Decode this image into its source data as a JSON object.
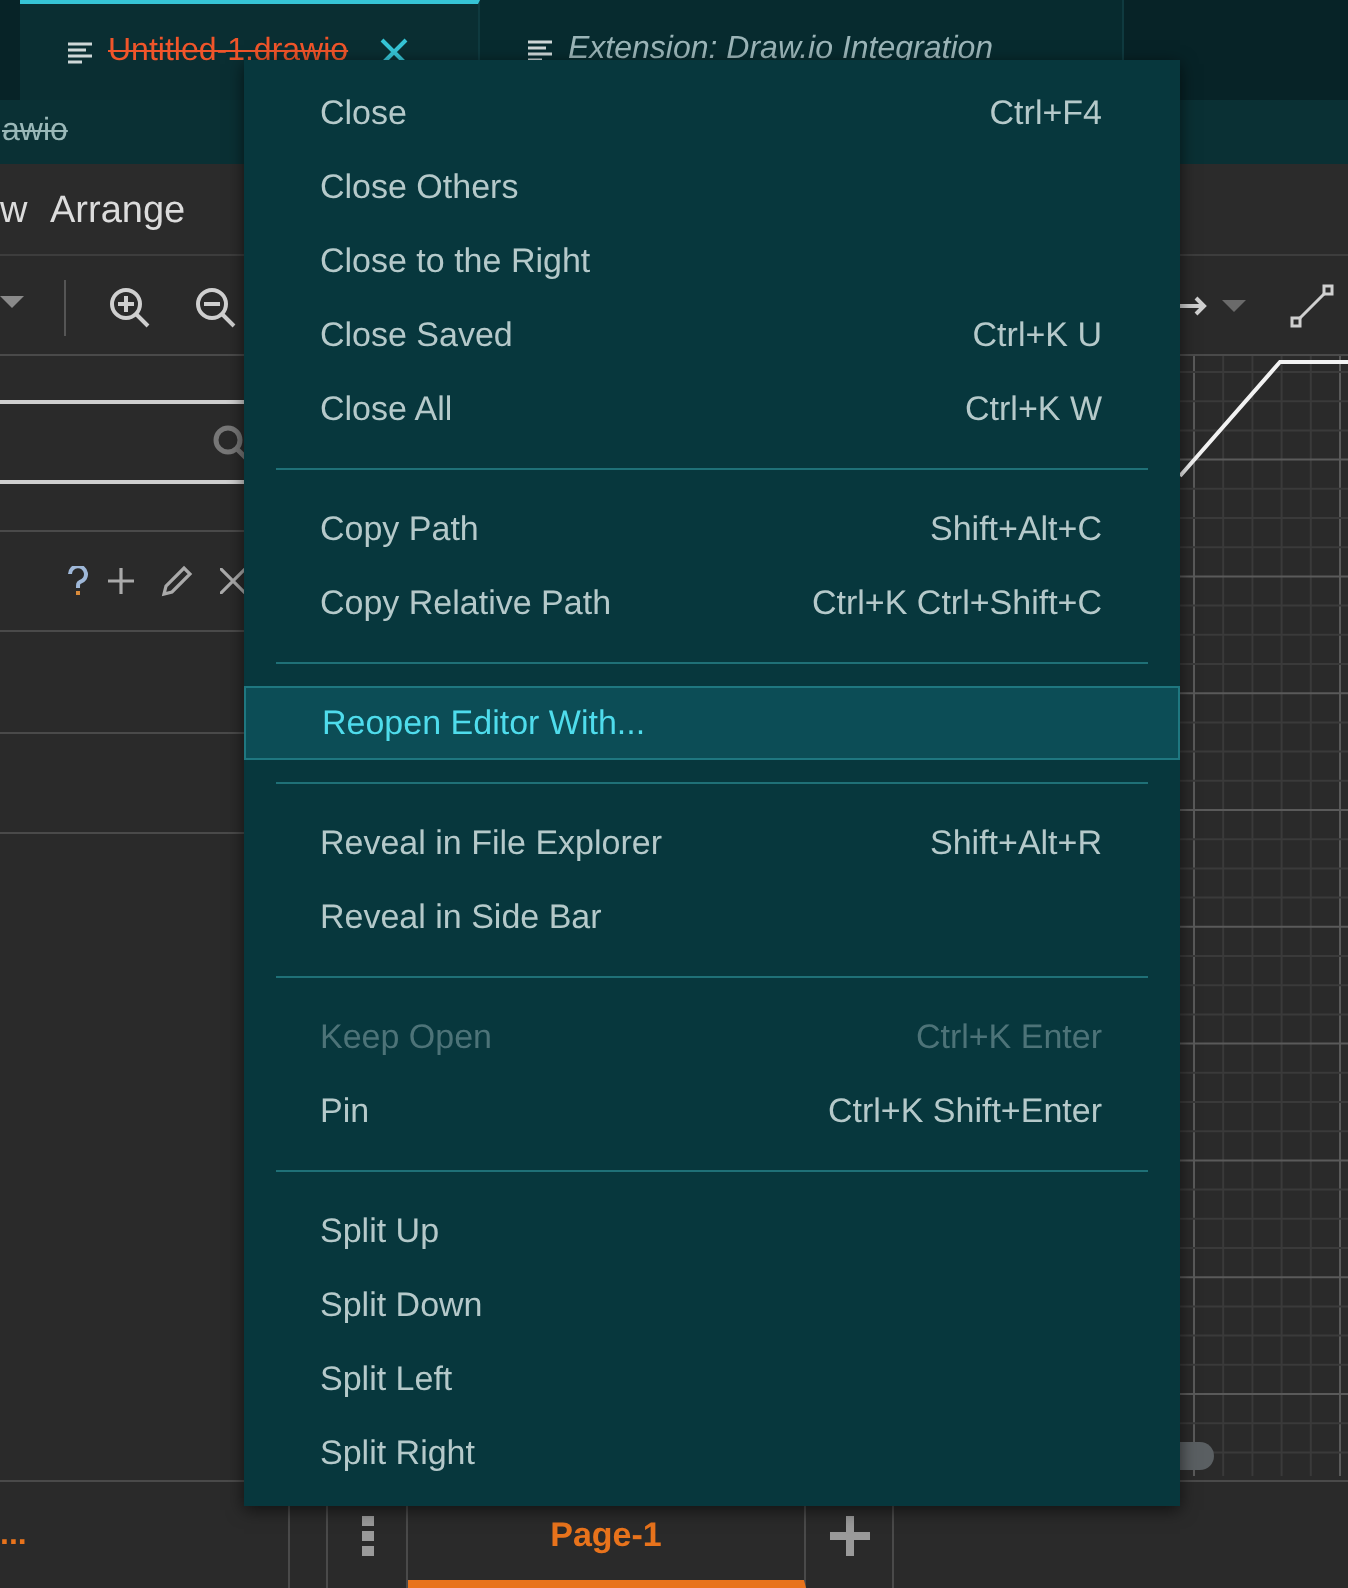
{
  "editor_tabs": [
    {
      "label": "Untitled-1.drawio",
      "selected": true,
      "deleted": true,
      "italic": false
    },
    {
      "label": "Extension: Draw.io Integration",
      "selected": false,
      "deleted": false,
      "italic": true
    }
  ],
  "breadcrumb": {
    "label": "awio",
    "deleted": true
  },
  "menu_bar": [
    "w",
    "Arrange"
  ],
  "context_menu": [
    [
      {
        "label": "Close",
        "shortcut": "Ctrl+F4",
        "disabled": false,
        "selected": false
      },
      {
        "label": "Close Others",
        "disabled": false,
        "selected": false
      },
      {
        "label": "Close to the Right",
        "disabled": false,
        "selected": false
      },
      {
        "label": "Close Saved",
        "shortcut": "Ctrl+K U",
        "disabled": false,
        "selected": false
      },
      {
        "label": "Close All",
        "shortcut": "Ctrl+K W",
        "disabled": false,
        "selected": false
      }
    ],
    [
      {
        "label": "Copy Path",
        "shortcut": "Shift+Alt+C",
        "disabled": false,
        "selected": false
      },
      {
        "label": "Copy Relative Path",
        "shortcut": "Ctrl+K Ctrl+Shift+C",
        "disabled": false,
        "selected": false
      }
    ],
    [
      {
        "label": "Reopen Editor With...",
        "disabled": false,
        "selected": true
      }
    ],
    [
      {
        "label": "Reveal in File Explorer",
        "shortcut": "Shift+Alt+R",
        "disabled": false,
        "selected": false
      },
      {
        "label": "Reveal in Side Bar",
        "disabled": false,
        "selected": false
      }
    ],
    [
      {
        "label": "Keep Open",
        "shortcut": "Ctrl+K Enter",
        "disabled": true,
        "selected": false
      },
      {
        "label": "Pin",
        "shortcut": "Ctrl+K Shift+Enter",
        "disabled": false,
        "selected": false
      }
    ],
    [
      {
        "label": "Split Up",
        "disabled": false,
        "selected": false
      },
      {
        "label": "Split Down",
        "disabled": false,
        "selected": false
      },
      {
        "label": "Split Left",
        "disabled": false,
        "selected": false
      },
      {
        "label": "Split Right",
        "disabled": false,
        "selected": false
      }
    ]
  ],
  "bottom_bar": {
    "status": "...",
    "page_tabs": [
      {
        "label": "Page-1",
        "selected": true
      }
    ]
  }
}
